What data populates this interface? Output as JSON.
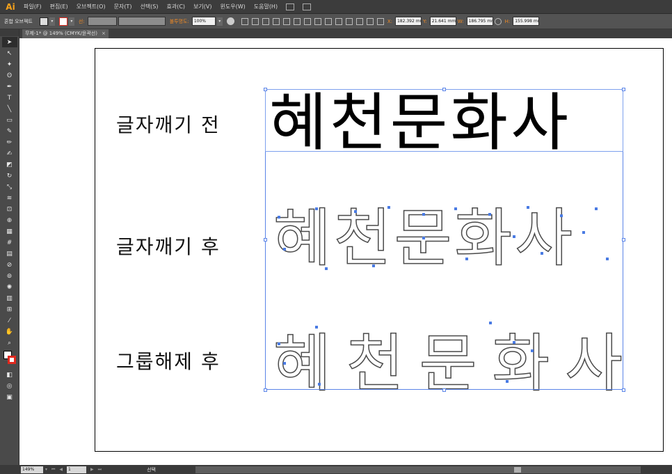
{
  "app": {
    "logo": "Ai",
    "accent": "#f7a21b"
  },
  "menu": {
    "items": [
      "파일(F)",
      "편집(E)",
      "오브젝트(O)",
      "문자(T)",
      "선택(S)",
      "효과(C)",
      "보기(V)",
      "윈도우(W)",
      "도움말(H)"
    ]
  },
  "controlbar": {
    "selection_label": "혼합 오브젝트",
    "stroke_label": "선:",
    "opacity_label": "불투명도:",
    "opacity_value": "100%",
    "x_label": "X:",
    "x_value": "182.392 mm",
    "y_label": "Y:",
    "y_value": "21.641 mm",
    "w_label": "W:",
    "w_value": "186.795 mm",
    "h_label": "H:",
    "h_value": "155.998 mm"
  },
  "tab": {
    "title": "무제-1* @ 149% (CMYK/윤곽선)",
    "close": "×"
  },
  "artwork": {
    "row1_label": "글자깨기 전",
    "row2_label": "글자깨기 후",
    "row3_label": "그룹해제 후",
    "headline": "혜천문화사",
    "selection_color": "#5a84e8",
    "stroke_color": "#e0281e"
  },
  "statusbar": {
    "zoom": "149%",
    "page": "1",
    "status": "선택"
  }
}
